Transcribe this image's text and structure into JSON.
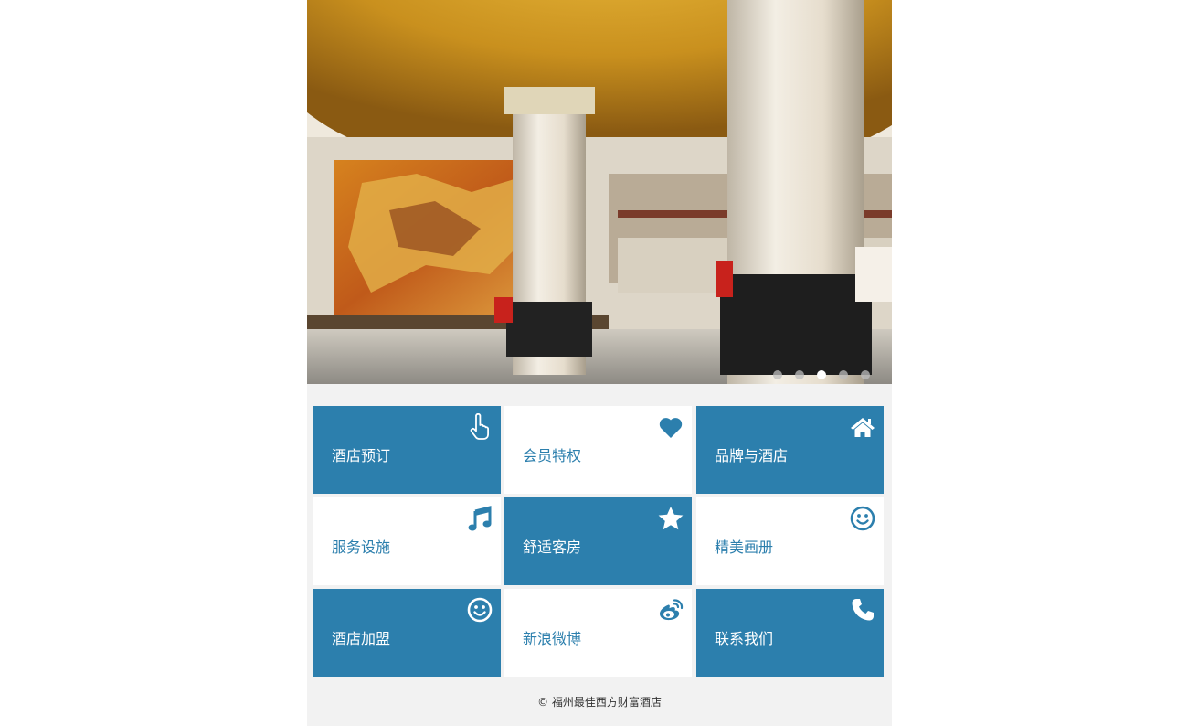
{
  "banner": {
    "image_alt": "hotel-lobby-photo",
    "slides": 5,
    "active_slide": 3
  },
  "tiles": [
    {
      "label": "酒店预订",
      "icon": "hand-pointer-icon",
      "style": "blue"
    },
    {
      "label": "会员特权",
      "icon": "heart-icon",
      "style": "white"
    },
    {
      "label": "品牌与酒店",
      "icon": "home-icon",
      "style": "blue"
    },
    {
      "label": "服务设施",
      "icon": "music-icon",
      "style": "white"
    },
    {
      "label": "舒适客房",
      "icon": "star-icon",
      "style": "blue"
    },
    {
      "label": "精美画册",
      "icon": "smile-icon",
      "style": "white"
    },
    {
      "label": "酒店加盟",
      "icon": "smile-icon",
      "style": "blue"
    },
    {
      "label": "新浪微博",
      "icon": "weibo-icon",
      "style": "white"
    },
    {
      "label": "联系我们",
      "icon": "phone-icon",
      "style": "blue"
    }
  ],
  "footer": {
    "copyright": "© 福州最佳西方财富酒店"
  },
  "colors": {
    "tile_blue": "#2c7fad",
    "tile_white": "#ffffff",
    "page_bg": "#f2f2f2"
  }
}
